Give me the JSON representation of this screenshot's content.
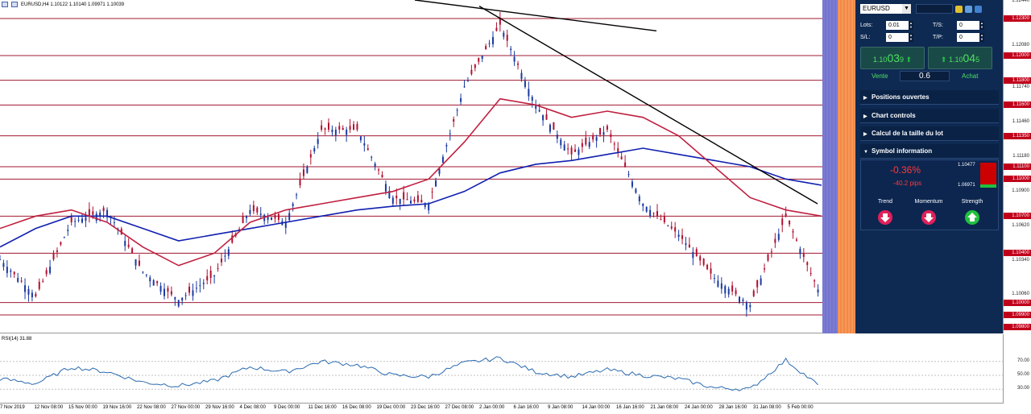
{
  "header": {
    "symbol_line": "EURUSD,H4  1.10122 1.10140 1.09971 1.10039"
  },
  "price_axis": {
    "ticks": [
      "1.12440",
      "1.12080",
      "1.11740",
      "1.11460",
      "1.11180",
      "1.10900",
      "1.10620",
      "1.10340",
      "1.10060"
    ],
    "boxes": [
      "1.12300",
      "1.12000",
      "1.11800",
      "1.11600",
      "1.11350",
      "1.11100",
      "1.11000",
      "1.10700",
      "1.10400",
      "1.10000",
      "1.09900",
      "1.09800"
    ]
  },
  "rsi": {
    "label": "RSI(14) 31.88",
    "ticks": [
      "70.00",
      "50.00",
      "30.00"
    ]
  },
  "time_axis": {
    "labels": [
      "7 Nov 2019",
      "12 Nov 08:00",
      "15 Nov 00:00",
      "19 Nov 16:00",
      "22 Nov 08:00",
      "27 Nov 00:00",
      "29 Nov 16:00",
      "4 Dec 08:00",
      "9 Dec 00:00",
      "11 Dec 16:00",
      "16 Dec 08:00",
      "19 Dec 00:00",
      "23 Dec 16:00",
      "27 Dec 08:00",
      "2 Jan 00:00",
      "6 Jan 16:00",
      "9 Jan 08:00",
      "14 Jan 00:00",
      "16 Jan 16:00",
      "21 Jan 08:00",
      "24 Jan 00:00",
      "28 Jan 16:00",
      "31 Jan 08:00",
      "5 Feb 00:00"
    ]
  },
  "panel": {
    "symbol": "EURUSD",
    "lots_label": "Lots:",
    "lots_value": "0.01",
    "ts_label": "T/S:",
    "ts_value": "0",
    "sl_label": "S/L:",
    "sl_value": "0",
    "tp_label": "T/P:",
    "tp_value": "0",
    "sell": {
      "small": "1.10",
      "big": "03",
      "sup": "9",
      "label": "Vente"
    },
    "buy": {
      "small": "1.10",
      "big": "04",
      "sup": "5",
      "label": "Achat"
    },
    "lot_size": "0.6",
    "sections": [
      "Positions ouvertes",
      "Chart controls",
      "Calcul de la taille du lot",
      "Symbol information"
    ],
    "symbol_info": {
      "change_pct": "-0.36%",
      "change_pips": "-40.2 pips",
      "high": "1.10477",
      "low": "1.06971",
      "indicators": [
        {
          "label": "Trend",
          "direction": "down"
        },
        {
          "label": "Momentum",
          "direction": "down"
        },
        {
          "label": "Strength",
          "direction": "up"
        }
      ]
    },
    "colors": {
      "bg": "#0e2a52",
      "down": "#e0205a",
      "up": "#20c040",
      "sell_text": "#4ce060"
    }
  },
  "chart_data": {
    "type": "line",
    "title": "EURUSD,H4",
    "x": [
      "7 Nov 2019",
      "12 Nov 08:00",
      "15 Nov 00:00",
      "19 Nov 16:00",
      "22 Nov 08:00",
      "27 Nov 00:00",
      "29 Nov 16:00",
      "4 Dec 08:00",
      "9 Dec 00:00",
      "11 Dec 16:00",
      "16 Dec 08:00",
      "19 Dec 00:00",
      "23 Dec 16:00",
      "27 Dec 08:00",
      "2 Jan 00:00",
      "6 Jan 16:00",
      "9 Jan 08:00",
      "14 Jan 00:00",
      "16 Jan 16:00",
      "21 Jan 08:00",
      "24 Jan 00:00",
      "28 Jan 16:00",
      "31 Jan 08:00",
      "5 Feb 00:00"
    ],
    "series": [
      {
        "name": "EURUSD",
        "values": [
          1.1035,
          1.1005,
          1.1065,
          1.1075,
          1.1025,
          1.1002,
          1.1022,
          1.1075,
          1.1065,
          1.114,
          1.114,
          1.1085,
          1.108,
          1.1175,
          1.1225,
          1.116,
          1.112,
          1.114,
          1.108,
          1.1055,
          1.102,
          1.0998,
          1.107,
          1.1004
        ]
      },
      {
        "values": [
          1.1045,
          1.106,
          1.107,
          1.107,
          1.106,
          1.105,
          1.1055,
          1.106,
          1.1065,
          1.107,
          1.1075,
          1.1078,
          1.108,
          1.109,
          1.1105,
          1.1112,
          1.1115,
          1.112,
          1.1125,
          1.112,
          1.1115,
          1.111,
          1.11,
          1.1095
        ]
      },
      {
        "values": [
          1.106,
          1.107,
          1.1075,
          1.1065,
          1.1045,
          1.103,
          1.104,
          1.1065,
          1.1075,
          1.108,
          1.1085,
          1.109,
          1.11,
          1.113,
          1.1165,
          1.116,
          1.115,
          1.1155,
          1.115,
          1.1135,
          1.111,
          1.1085,
          1.1075,
          1.107
        ]
      }
    ],
    "rsi": [
      45,
      38,
      62,
      55,
      40,
      35,
      42,
      62,
      55,
      70,
      65,
      50,
      48,
      68,
      75,
      55,
      48,
      58,
      50,
      45,
      32,
      30,
      72,
      32
    ],
    "ylim": [
      1.0975,
      1.1245
    ],
    "levels": [
      1.123,
      1.12,
      1.118,
      1.116,
      1.1135,
      1.111,
      1.11,
      1.107,
      1.104,
      1.1,
      1.099
    ],
    "trendlines": 2
  }
}
